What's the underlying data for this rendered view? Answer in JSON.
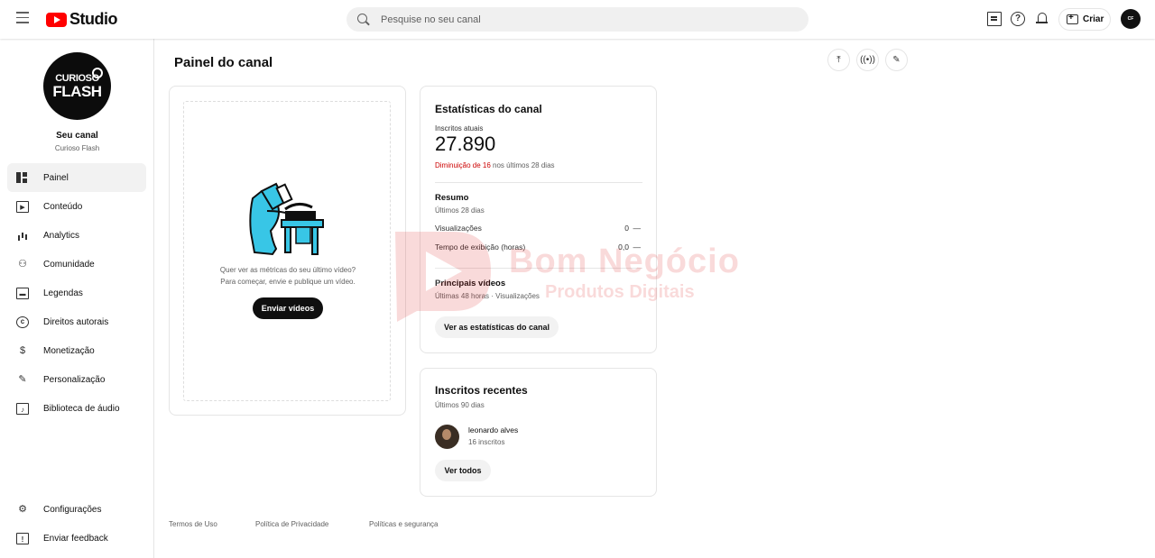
{
  "header": {
    "app_name": "Studio",
    "search_placeholder": "Pesquise no seu canal",
    "create_label": "Criar"
  },
  "sidebar": {
    "channel_logo_line1": "CURIOSO",
    "channel_logo_line2": "FLASH",
    "channel_title": "Seu canal",
    "channel_name": "Curioso Flash",
    "items": [
      {
        "label": "Painel",
        "icon": "dashboard-icon",
        "active": true
      },
      {
        "label": "Conteúdo",
        "icon": "content-icon"
      },
      {
        "label": "Analytics",
        "icon": "analytics-icon"
      },
      {
        "label": "Comunidade",
        "icon": "community-icon"
      },
      {
        "label": "Legendas",
        "icon": "subtitles-icon"
      },
      {
        "label": "Direitos autorais",
        "icon": "copyright-icon"
      },
      {
        "label": "Monetização",
        "icon": "monetization-icon"
      },
      {
        "label": "Personalização",
        "icon": "customization-icon"
      },
      {
        "label": "Biblioteca de áudio",
        "icon": "audio-library-icon"
      }
    ],
    "bottom_items": [
      {
        "label": "Configurações",
        "icon": "settings-icon"
      },
      {
        "label": "Enviar feedback",
        "icon": "feedback-icon"
      }
    ]
  },
  "main": {
    "page_title": "Painel do canal",
    "video_card": {
      "question_line1": "Quer ver as métricas do seu último vídeo?",
      "question_line2": "Para começar, envie e publique um vídeo.",
      "upload_button": "Enviar vídeos"
    },
    "stats_card": {
      "title": "Estatísticas do canal",
      "subscribers_label": "Inscritos atuais",
      "subscribers_value": "27.890",
      "change_highlight": "Diminuição de 16",
      "change_rest": " nos últimos 28 dias",
      "summary_title": "Resumo",
      "summary_period": "Últimos 28 dias",
      "views_label": "Visualizações",
      "views_value": "0",
      "watch_label": "Tempo de exibição (horas)",
      "watch_value": "0,0",
      "dash": "—",
      "top_videos_title": "Principais vídeos",
      "top_videos_period": "Últimas 48 horas · Visualizações",
      "analytics_button": "Ver as estatísticas do canal"
    },
    "recent_card": {
      "title": "Inscritos recentes",
      "period": "Últimos 90 dias",
      "subscriber_name": "leonardo alves",
      "subscriber_count": "16 inscritos",
      "see_all_button": "Ver todos"
    }
  },
  "footer": {
    "links": [
      "Termos de Uso",
      "Política de Privacidade",
      "Políticas e segurança"
    ]
  },
  "watermark": {
    "line1": "Bom Negócio",
    "line2": "Produtos Digitais"
  },
  "colors": {
    "brand_red": "#ff0000",
    "decrease_red": "#cc0000",
    "illustration_cyan": "#38c6e6"
  }
}
